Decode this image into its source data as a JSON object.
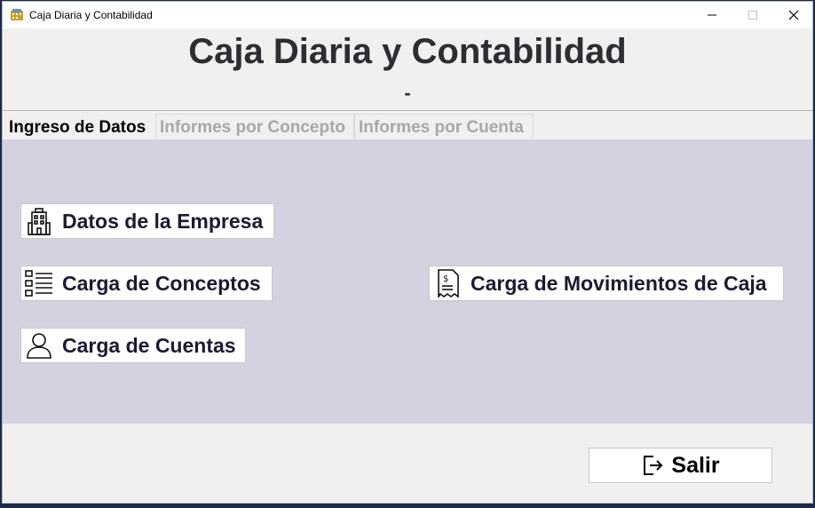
{
  "window": {
    "title": "Caja Diaria y Contabilidad",
    "controls": {
      "minimize": "minimize-icon",
      "maximize": "maximize-icon",
      "close": "close-icon"
    }
  },
  "header": {
    "title": "Caja Diaria y Contabilidad",
    "subtitle": "-"
  },
  "tabs": [
    {
      "label": "Ingreso de Datos",
      "active": true
    },
    {
      "label": "Informes por Concepto",
      "active": false
    },
    {
      "label": "Informes por Cuenta",
      "active": false
    }
  ],
  "buttons": {
    "empresa": {
      "label": "Datos de la Empresa",
      "icon": "building-icon"
    },
    "conceptos": {
      "label": "Carga de Conceptos",
      "icon": "list-checkbox-icon"
    },
    "cuentas": {
      "label": "Carga de Cuentas",
      "icon": "user-icon"
    },
    "movimientos": {
      "label": "Carga de Movimientos de Caja",
      "icon": "receipt-icon"
    }
  },
  "footer": {
    "exit_label": "Salir",
    "exit_icon": "exit-icon"
  },
  "colors": {
    "panel_background": "#d2d2e0",
    "window_background": "#f0f0f0",
    "title_text": "#2b2f33",
    "button_text": "#1a1a33",
    "inactive_tab_text": "#a8a8a8"
  }
}
